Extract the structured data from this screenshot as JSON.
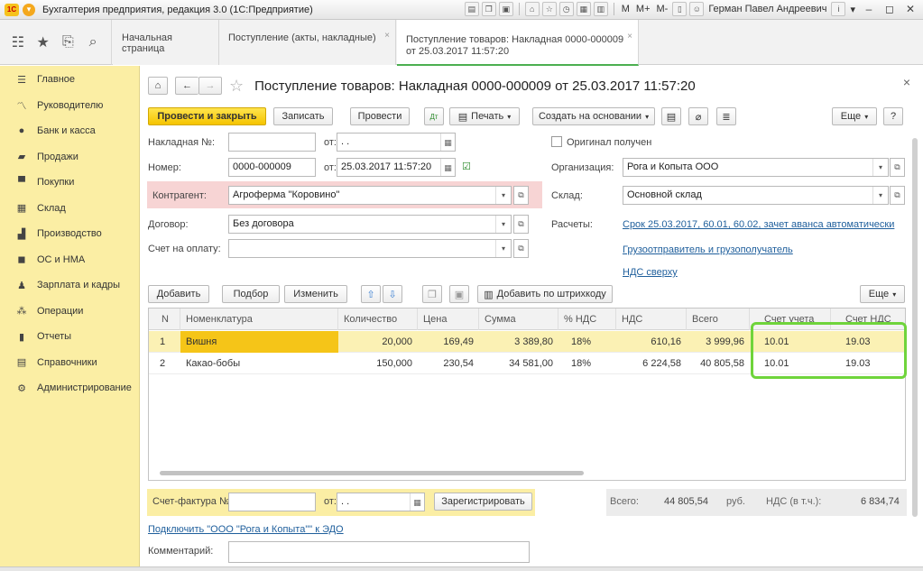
{
  "titlebar": {
    "logo": "1С",
    "title": "Бухгалтерия предприятия, редакция 3.0  (1С:Предприятие)",
    "user": "Герман Павел Андреевич",
    "m": "M",
    "mplus": "M+",
    "mminus": "M-"
  },
  "tabs": [
    {
      "label": "Начальная страница"
    },
    {
      "label": "Поступление (акты, накладные)"
    },
    {
      "label": "Поступление товаров: Накладная 0000-000009",
      "label2": "от 25.03.2017 11:57:20"
    }
  ],
  "sidebar": {
    "items": [
      {
        "label": "Главное",
        "icon": "menu-icon"
      },
      {
        "label": "Руководителю",
        "icon": "chart-icon"
      },
      {
        "label": "Банк и касса",
        "icon": "coin-icon"
      },
      {
        "label": "Продажи",
        "icon": "bag-icon"
      },
      {
        "label": "Покупки",
        "icon": "cart-icon"
      },
      {
        "label": "Склад",
        "icon": "grid-icon"
      },
      {
        "label": "Производство",
        "icon": "factory-icon"
      },
      {
        "label": "ОС и НМА",
        "icon": "truck-icon"
      },
      {
        "label": "Зарплата и кадры",
        "icon": "person-icon"
      },
      {
        "label": "Операции",
        "icon": "operations-icon"
      },
      {
        "label": "Отчеты",
        "icon": "report-icon"
      },
      {
        "label": "Справочники",
        "icon": "book-icon"
      },
      {
        "label": "Администрирование",
        "icon": "gear-icon"
      }
    ]
  },
  "document": {
    "title": "Поступление товаров: Накладная 0000-000009 от 25.03.2017 11:57:20"
  },
  "toolbar": {
    "post_close": "Провести и закрыть",
    "save": "Записать",
    "post": "Провести",
    "print": "Печать",
    "create_based": "Создать на основании",
    "more": "Еще",
    "help": "?"
  },
  "form": {
    "invoice_no_label": "Накладная №:",
    "invoice_no_value": "",
    "from_label": "от:",
    "invoice_date_value": " .  .",
    "number_label": "Номер:",
    "number_value": "0000-000009",
    "date_value": "25.03.2017 11:57:20",
    "counterparty_label": "Контрагент:",
    "counterparty_value": "Агроферма \"Коровино\"",
    "contract_label": "Договор:",
    "contract_value": "Без договора",
    "payment_account_label": "Счет на оплату:",
    "payment_account_value": "",
    "original_label": "Оригинал получен",
    "org_label": "Организация:",
    "org_value": "Рога и Копыта ООО",
    "warehouse_label": "Склад:",
    "warehouse_value": "Основной склад",
    "settlements_label": "Расчеты:",
    "settlements_link": "Срок 25.03.2017, 60.01, 60.02, зачет аванса автоматически",
    "shipper_link": "Грузоотправитель и грузополучатель",
    "vat_link": "НДС сверху"
  },
  "table_toolbar": {
    "add": "Добавить",
    "select": "Подбор",
    "change": "Изменить",
    "barcode": "Добавить по штрихкоду",
    "more": "Еще"
  },
  "table": {
    "columns": [
      "N",
      "Номенклатура",
      "Количество",
      "Цена",
      "Сумма",
      "% НДС",
      "НДС",
      "Всего",
      "Счет учета",
      "Счет НДС"
    ],
    "rows": [
      [
        "1",
        "Вишня",
        "20,000",
        "169,49",
        "3 389,80",
        "18%",
        "610,16",
        "3 999,96",
        "10.01",
        "19.03"
      ],
      [
        "2",
        "Какао-бобы",
        "150,000",
        "230,54",
        "34 581,00",
        "18%",
        "6 224,58",
        "40 805,58",
        "10.01",
        "19.03"
      ]
    ]
  },
  "footer": {
    "invoice_label": "Счет-фактура №:",
    "invoice_value": "",
    "from_label": "от:",
    "date_value": " .  .",
    "register": "Зарегистрировать",
    "total_label": "Всего:",
    "total_value": "44 805,54",
    "currency": "руб.",
    "vat_label": "НДС (в т.ч.):",
    "vat_value": "6 834,74",
    "edo_link": "Подключить \"ООО \"Рога и Копыта\"\" к ЭДО",
    "comment_label": "Комментарий:",
    "comment_value": ""
  },
  "colors": {
    "sidebar": "#fbeea4",
    "accent_yellow": "#f5c400",
    "highlight_box": "#6fd43b",
    "link": "#1f5f9c"
  }
}
